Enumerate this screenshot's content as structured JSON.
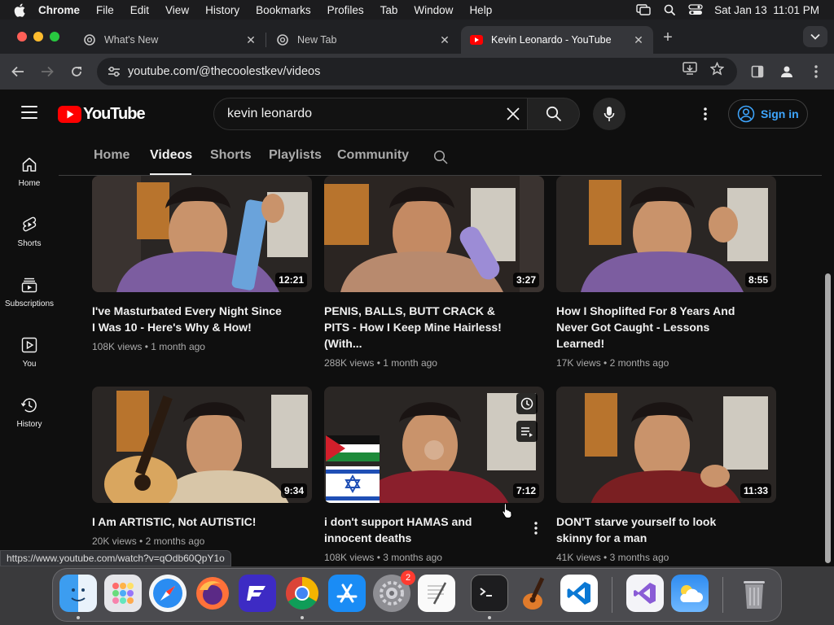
{
  "menubar": {
    "app": "Chrome",
    "items": [
      "File",
      "Edit",
      "View",
      "History",
      "Bookmarks",
      "Profiles",
      "Tab",
      "Window",
      "Help"
    ],
    "datetime": "Sat Jan 13  11:01 PM"
  },
  "tabs": [
    {
      "title": "What's New",
      "active": false
    },
    {
      "title": "New Tab",
      "active": false
    },
    {
      "title": "Kevin Leonardo - YouTube",
      "active": true
    }
  ],
  "toolbar": {
    "url": "youtube.com/@thecoolestkev/videos"
  },
  "youtube": {
    "logo_text": "YouTube",
    "search_query": "kevin leonardo",
    "sign_in_label": "Sign in",
    "guide": [
      {
        "label": "Home",
        "icon": "home-icon"
      },
      {
        "label": "Shorts",
        "icon": "shorts-icon"
      },
      {
        "label": "Subscriptions",
        "icon": "subscriptions-icon"
      },
      {
        "label": "You",
        "icon": "you-icon"
      },
      {
        "label": "History",
        "icon": "history-icon"
      }
    ],
    "channel_tabs": [
      "Home",
      "Videos",
      "Shorts",
      "Playlists",
      "Community"
    ],
    "active_channel_tab": "Videos",
    "videos": [
      {
        "title": "I've Masturbated Every Night Since I Was 10 - Here's Why & How!",
        "views": "108K views",
        "age": "1 month ago",
        "duration": "12:21",
        "shirt": "#7c5da0"
      },
      {
        "title": "PENIS, BALLS, BUTT CRACK & PITS - How I Keep Mine Hairless! (With...",
        "views": "288K views",
        "age": "1 month ago",
        "duration": "3:27",
        "shirt": "#b88a6e"
      },
      {
        "title": "How I Shoplifted For 8 Years And Never Got Caught - Lessons Learned!",
        "views": "17K views",
        "age": "2 months ago",
        "duration": "8:55",
        "shirt": "#7c5da0"
      },
      {
        "title": "I Am ARTISTIC, Not AUTISTIC!",
        "views": "20K views",
        "age": "2 months ago",
        "duration": "9:34",
        "shirt": "#d8c6a8"
      },
      {
        "title": "i don't support HAMAS and innocent deaths",
        "views": "108K views",
        "age": "3 months ago",
        "duration": "7:12",
        "shirt": "#8a1f2c"
      },
      {
        "title": "DON'T starve yourself to look skinny for a man",
        "views": "41K views",
        "age": "3 months ago",
        "duration": "11:33",
        "shirt": "#7a1f22"
      }
    ]
  },
  "status_url": "https://www.youtube.com/watch?v=qOdb60QpY1o",
  "dock": {
    "apps": [
      "finder-icon",
      "launchpad-icon",
      "safari-icon",
      "firefox-icon",
      "fenix-icon",
      "chrome-icon",
      "app-store-icon",
      "system-settings-icon",
      "textedit-icon",
      "terminal-icon",
      "garageband-icon",
      "vscode-icon",
      "visual-studio-icon",
      "weather-icon",
      "trash-icon"
    ],
    "settings_badge": "2"
  },
  "colors": {
    "yt_red": "#ff0000",
    "yt_bg": "#0f0f0f",
    "link_blue": "#3ea6ff",
    "chrome_dark": "#202124"
  }
}
